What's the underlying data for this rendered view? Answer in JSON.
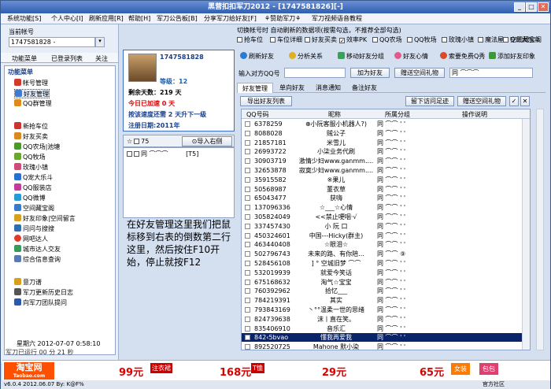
{
  "window": {
    "title": "黑营扣扣军刀2012 - [1747581826][-]"
  },
  "menu": [
    "系统功能[S]",
    "个人中心[I]",
    "刷新应用[R]",
    "帮助[H]",
    "军刀公告板[B]",
    "分享军刀给好友[F]",
    "⚘赞助军刀⚘",
    "军刀视频语音教程"
  ],
  "left": {
    "current_account_label": "当前帐号",
    "account_value": "1747581828 -",
    "tabs": [
      "功能菜单",
      "已登录列表",
      "关注"
    ],
    "menu_header": "功能菜单",
    "items": [
      {
        "label": "帐号管理",
        "icon": "#d23a2a"
      },
      {
        "label": "好友管理",
        "icon": "#3f7bd6"
      },
      {
        "label": "QQ群管理",
        "icon": "#e08a1c"
      },
      {
        "label": "新抢车位",
        "icon": "#c33"
      },
      {
        "label": "好友买卖",
        "icon": "#d88a20"
      },
      {
        "label": "QQ农场|池塘",
        "icon": "#4a9a2a"
      },
      {
        "label": "QQ牧场",
        "icon": "#6aa630"
      },
      {
        "label": "玫瑰小镇",
        "icon": "#d14a7a"
      },
      {
        "label": "Q宠大乐斗",
        "icon": "#2a6fcf"
      },
      {
        "label": "QQ服装店",
        "icon": "#c83a9a"
      },
      {
        "label": "QQ微博",
        "icon": "#2a9ad6"
      },
      {
        "label": "空间藏宝阁",
        "icon": "#3a7acb"
      },
      {
        "label": "好友印象|空间留言",
        "icon": "#d6a020"
      },
      {
        "label": "问问与搜搜",
        "icon": "#2d6fb3"
      },
      {
        "label": "网吧达人",
        "icon": "#e03a2a"
      },
      {
        "label": "城市达人交友",
        "icon": "#3a9a5a"
      },
      {
        "label": "综合信息查询",
        "icon": "#5a7ab0"
      },
      {
        "label": "意刀谱",
        "icon": "#d7a01c"
      },
      {
        "label": "军刀更新历史日志",
        "icon": "#555"
      },
      {
        "label": "向军刀团队提问",
        "icon": "#2a5ab0"
      }
    ],
    "status_date": "星期六 2012-07-07 0:58:10",
    "status_run": "军刀已运行 00 分 21 秒"
  },
  "profile": {
    "qq": "1747581828",
    "level": "等级：12",
    "days_left": "剩余天数：219 天",
    "today_bonus": "今日已加速 0 天",
    "speed_info": "按该速度还需 2 天升下一级",
    "register": "注册日期:2011年"
  },
  "friend_panel": {
    "count": "75",
    "import_button": "导入右侧",
    "first_friend": "同 ⌒⌒⌒",
    "first_tag": "[T5]"
  },
  "options": {
    "label": "切换帐号时 自动刷新的数据项(按需勾选，不推荐全部勾选)",
    "checks": [
      "抢车位",
      "车位详细",
      "好友买卖",
      "效率PK",
      "QQ农场",
      "QQ牧场",
      "玫瑰小镇",
      "魔法屋",
      "Q宠大乐斗",
      "空间藏宝阁"
    ]
  },
  "actions": [
    "刷新好友",
    "分析关系",
    "移动好友分组",
    "好友心情",
    "索要免费Q秀",
    "添加好友印象"
  ],
  "target": {
    "label": "输入对方QQ号",
    "add_button": "加为好友",
    "gift_button": "赠送空间礼物",
    "group_label": "同 ⌒⌒⌒"
  },
  "sub_tabs": [
    "好友管理",
    "单向好友",
    "消息通知",
    "备注好友"
  ],
  "list_toolbar": {
    "export": "导出好友列表",
    "visit": "留下访问足迹",
    "gift": "赠送空间礼物"
  },
  "columns": [
    "QQ号码",
    "昵称",
    "所属分组",
    "操作说明"
  ],
  "rows": [
    {
      "qq": "6378259",
      "nick": "⊕小阮客服小机器人?)",
      "grp": "同 ⌒⌒ ' '"
    },
    {
      "qq": "8088028",
      "nick": "贼公子",
      "grp": "同 ⌒⌒ ' '"
    },
    {
      "qq": "21857181",
      "nick": "米雪儿",
      "grp": "同 ⌒⌒ ' '"
    },
    {
      "qq": "26993722",
      "nick": "小柒业务代刷",
      "grp": "同 ⌒⌒ ' '"
    },
    {
      "qq": "30903719",
      "nick": "激情少妇www.ganmm....",
      "grp": "同 ⌒⌒ ' '"
    },
    {
      "qq": "32653878",
      "nick": "寂寞少妇www.ganmm....",
      "grp": "同 ⌒⌒ ' '"
    },
    {
      "qq": "35915582",
      "nick": "※果儿",
      "grp": "同 ⌒⌒ ' '"
    },
    {
      "qq": "50568987",
      "nick": "董衣草",
      "grp": "同 ⌒⌒ ' '"
    },
    {
      "qq": "65043477",
      "nick": "获嗨",
      "grp": "同 ⌒⌒ ' '"
    },
    {
      "qq": "137096336",
      "nick": "☆___☆心情",
      "grp": "同 ⌒⌒ ' '"
    },
    {
      "qq": "305824049",
      "nick": "<<禁止哽咽·√",
      "grp": "同 ⌒⌒ ' '"
    },
    {
      "qq": "337457430",
      "nick": "小 阮 口",
      "grp": "同 ⌒⌒ ' '"
    },
    {
      "qq": "450324601",
      "nick": "中国---Hicky(群主)",
      "grp": "同 ⌒⌒ ' '"
    },
    {
      "qq": "463440408",
      "nick": "☆眼泪☆",
      "grp": "同 ⌒⌒ ' '"
    },
    {
      "qq": "502796743",
      "nick": "未来的路、有你陪...",
      "grp": "同 ⌒⌒ ⑨"
    },
    {
      "qq": "528456108",
      "nick": "] ° 空城旧梦 ⌒⌒",
      "grp": "同 ⌒⌒ ' '"
    },
    {
      "qq": "532019939",
      "nick": "就爱今笑话",
      "grp": "同 ⌒⌒ ' '"
    },
    {
      "qq": "675168632",
      "nick": "淘气☆宝宝",
      "grp": "同 ⌒⌒ ' '"
    },
    {
      "qq": "760392962",
      "nick": "拾忆___",
      "grp": "同 ⌒⌒ ' '"
    },
    {
      "qq": "784219391",
      "nick": "其实",
      "grp": "同 ⌒⌒ ' '"
    },
    {
      "qq": "793843169",
      "nick": "丶°°温柔一世的思绪",
      "grp": "同 ⌒⌒ ' '"
    },
    {
      "qq": "824739638",
      "nick": "沫丨直在笑。",
      "grp": "同 ⌒⌒ ' '"
    },
    {
      "qq": "835406910",
      "nick": "音乐汇",
      "grp": "同 ⌒⌒ ' '"
    },
    {
      "qq": "842‹5bvao",
      "nick": "懂我再爱我",
      "grp": "同 ⌒⌒ ' '"
    },
    {
      "qq": "892520725",
      "nick": "Mahone 默小染",
      "grp": "同 ⌒⌒ ' '"
    }
  ],
  "annotation": "在好友管理这里我们把鼠标移到右表的倒数第二行这里，然后按住F10开始，停止就按F12",
  "banner": {
    "brand": "淘宝网",
    "brand_sub": "Taobao.com",
    "p1": "99元",
    "p1_tag": "注衣裙",
    "p2": "168元",
    "p2_tag": "T恤",
    "p3": "29元",
    "p4": "65元",
    "p5": "女装",
    "p6": "包包"
  },
  "statusbar": {
    "version": "v6.0.4 2012.06.07 By: K@F%",
    "right": "官方社区"
  }
}
